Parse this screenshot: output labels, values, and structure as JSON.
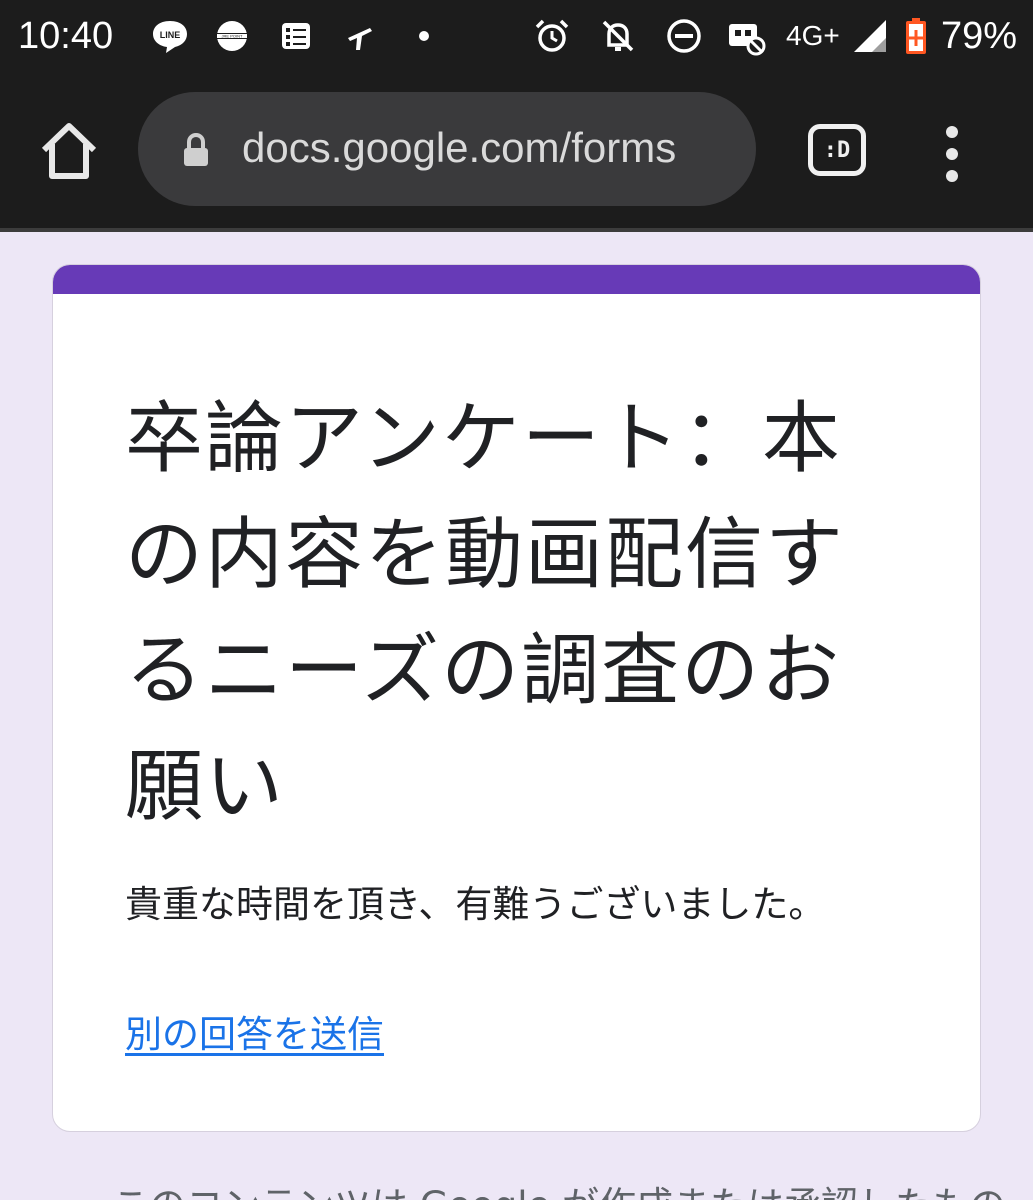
{
  "status_bar": {
    "time": "10:40",
    "network": "4G+",
    "battery_percent": "79%",
    "icons": [
      "line-icon",
      "jre-point-icon",
      "checklist-icon",
      "plane-icon",
      "dot-icon",
      "alarm-icon",
      "notifications-off-icon",
      "do-not-disturb-icon",
      "vpn-icon",
      "signal-icon",
      "battery-icon"
    ],
    "battery_color": "#ff5722"
  },
  "browser": {
    "url": "docs.google.com/forms",
    "tab_switcher_label": ":D"
  },
  "form": {
    "accent_color": "#673ab7",
    "title": "卒論アンケート：本の内容を動画配信するニーズの調査のお願い",
    "confirmation_message": "貴重な時間を頂き、有難うございました。",
    "resubmit_link": "別の回答を送信"
  },
  "footer": {
    "text": "このコンテンツは Google が作成または承認したもの"
  }
}
